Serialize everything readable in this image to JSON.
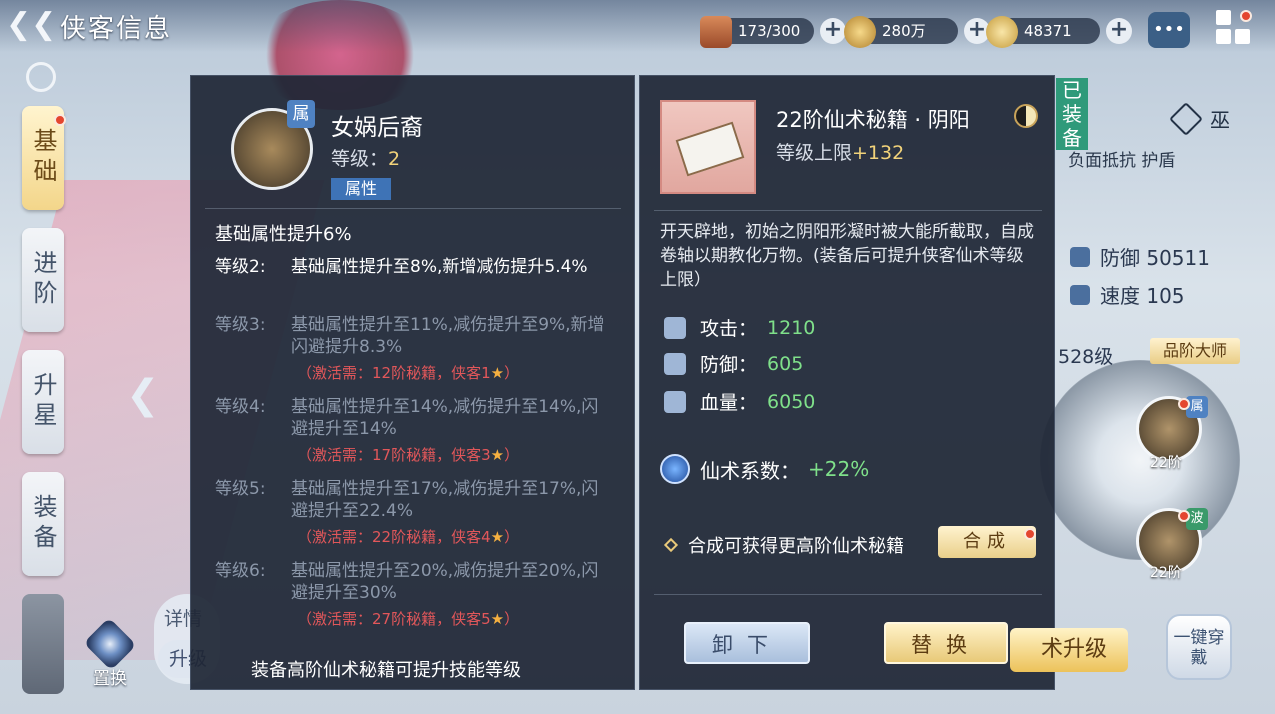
{
  "header": {
    "title": "侠客信息"
  },
  "resources": [
    {
      "icon": "chest-icon",
      "value": "173/300"
    },
    {
      "icon": "coin-icon",
      "value": "280万"
    },
    {
      "icon": "dragon-token-icon",
      "value": "48371"
    }
  ],
  "nav": {
    "tabs": [
      "基础",
      "进阶",
      "升星",
      "装备"
    ],
    "swap": "置换",
    "detail": "详情",
    "upgrade": "升级"
  },
  "skill": {
    "name": "女娲后裔",
    "tag": "属",
    "level_label": "等级：",
    "level": "2",
    "badge": "属性",
    "base": "基础属性提升6%",
    "levels": [
      {
        "label": "等级2:",
        "text": "基础属性提升至8%,新增减伤提升5.4%",
        "active": true,
        "req": ""
      },
      {
        "label": "等级3:",
        "text": "基础属性提升至11%,减伤提升至9%,新增闪避提升8.3%",
        "active": false,
        "req": "（激活需：12阶秘籍，侠客1"
      },
      {
        "label": "等级4:",
        "text": "基础属性提升至14%,减伤提升至14%,闪避提升至14%",
        "active": false,
        "req": "（激活需：17阶秘籍，侠客3"
      },
      {
        "label": "等级5:",
        "text": "基础属性提升至17%,减伤提升至17%,闪避提升至22.4%",
        "active": false,
        "req": "（激活需：22阶秘籍，侠客4"
      },
      {
        "label": "等级6:",
        "text": "基础属性提升至20%,减伤提升至20%,闪避提升至30%",
        "active": false,
        "req": "（激活需：27阶秘籍，侠客5"
      }
    ],
    "req_suffix": "）",
    "footnote": "装备高阶仙术秘籍可提升技能等级"
  },
  "book": {
    "title": "22阶仙术秘籍 · 阴阳",
    "limit_label": "等级上限",
    "limit_value": "+132",
    "desc": "开天辟地，初始之阴阳形凝时被大能所截取，自成卷轴以期教化万物。(装备后可提升侠客仙术等级上限）",
    "stats": [
      {
        "label": "攻击：",
        "value": "1210"
      },
      {
        "label": "防御：",
        "value": "605"
      },
      {
        "label": "血量：",
        "value": "6050"
      }
    ],
    "coef_label": "仙术系数：",
    "coef_value": "+22%",
    "synth_text": "合成可获得更高阶仙术秘籍",
    "synth_btn": "合成",
    "unload_btn": "卸下",
    "replace_btn": "替换"
  },
  "side": {
    "equipped": "已装备",
    "sect": "巫",
    "resist": "负面抵抗 护盾",
    "defense": "防御 50511",
    "speed": "速度 105",
    "level_partial": "528级",
    "grade_btn": "品阶大师",
    "slots": [
      {
        "tag": "属",
        "step": "22阶"
      },
      {
        "tag": "波",
        "step": "22阶"
      }
    ],
    "upgrade_btn": "术升级",
    "wear_btn": "一键穿戴"
  },
  "colors": {
    "panel": "#1f2736",
    "accent_gold": "#f2d37a",
    "positive": "#7fe08a",
    "warning": "#e2575a"
  }
}
